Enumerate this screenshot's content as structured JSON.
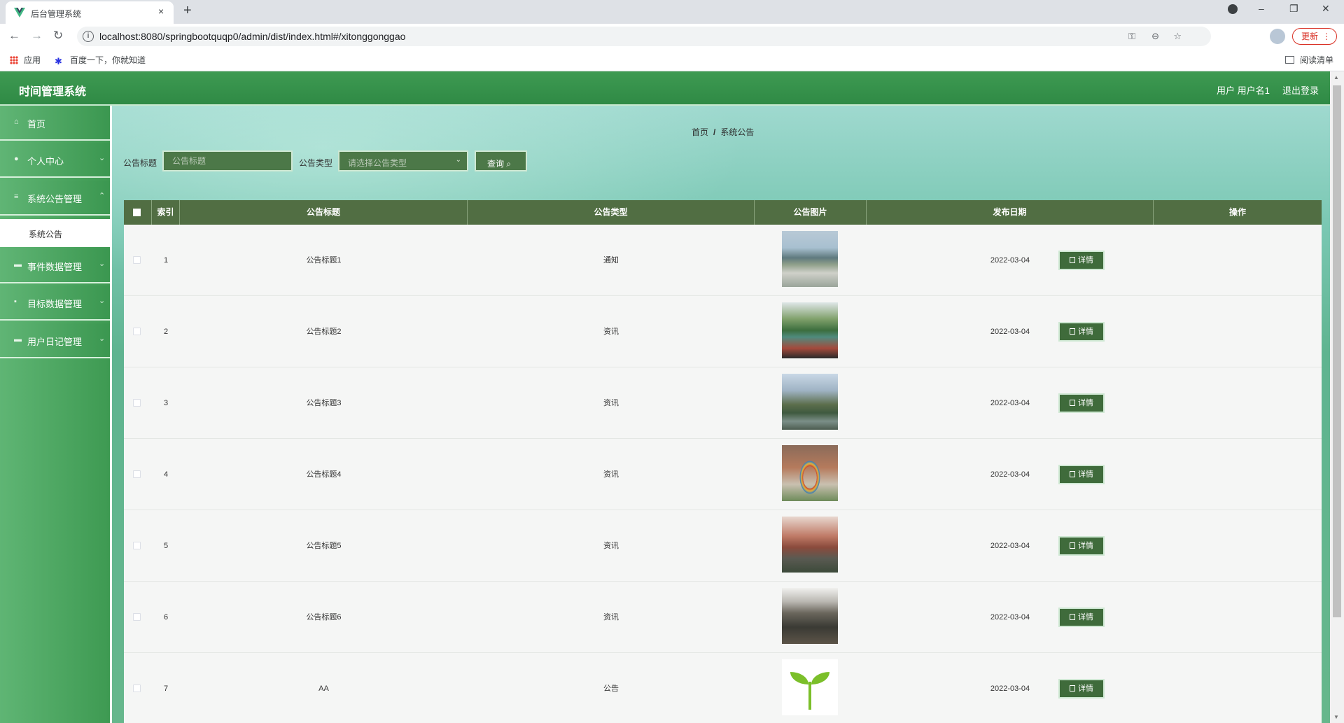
{
  "browser": {
    "tab_title": "后台管理系统",
    "tab_close": "×",
    "new_tab": "+",
    "url": "localhost:8080/springbootquqp0/admin/dist/index.html#/xitonggonggao",
    "update_label": "更新",
    "bookmarks": [
      "应用",
      "百度一下，你就知道"
    ],
    "reading_list": "阅读清单"
  },
  "app": {
    "title": "时间管理系统",
    "user_label": "用户 用户名1",
    "logout": "退出登录"
  },
  "sidebar": {
    "items": [
      {
        "label": "首页",
        "icon": "home-icon",
        "glyph": "⌂"
      },
      {
        "label": "个人中心",
        "icon": "user-icon",
        "glyph": "●"
      },
      {
        "label": "系统公告管理",
        "icon": "list-icon",
        "glyph": "≡"
      },
      {
        "label": "事件数据管理",
        "icon": "ticket-icon",
        "glyph": "▬"
      },
      {
        "label": "目标数据管理",
        "icon": "grid-icon",
        "glyph": "▪"
      },
      {
        "label": "用户日记管理",
        "icon": "storage-icon",
        "glyph": "▬"
      }
    ],
    "submenu_active": "系统公告"
  },
  "breadcrumb": {
    "home": "首页",
    "separator": "/",
    "current": "系统公告"
  },
  "search": {
    "title_label": "公告标题",
    "title_placeholder": "公告标题",
    "type_label": "公告类型",
    "type_placeholder": "请选择公告类型",
    "query_button": "查询"
  },
  "table": {
    "headers": [
      "索引",
      "公告标题",
      "公告类型",
      "公告图片",
      "发布日期",
      "操作"
    ],
    "detail_label": "详情",
    "rows": [
      {
        "index": "1",
        "title": "公告标题1",
        "type": "通知",
        "date": "2022-03-04",
        "image": "buildings"
      },
      {
        "index": "2",
        "title": "公告标题2",
        "type": "资讯",
        "date": "2022-03-04",
        "image": "court"
      },
      {
        "index": "3",
        "title": "公告标题3",
        "type": "资讯",
        "date": "2022-03-04",
        "image": "lake"
      },
      {
        "index": "4",
        "title": "公告标题4",
        "type": "资讯",
        "date": "2022-03-04",
        "image": "sculpture"
      },
      {
        "index": "5",
        "title": "公告标题5",
        "type": "资讯",
        "date": "2022-03-04",
        "image": "campus"
      },
      {
        "index": "6",
        "title": "公告标题6",
        "type": "资讯",
        "date": "2022-03-04",
        "image": "room"
      },
      {
        "index": "7",
        "title": "AA",
        "type": "公告",
        "date": "2022-03-04",
        "image": "sprout"
      }
    ]
  },
  "colors": {
    "header_green": "#3e9a52",
    "table_header": "#516e43",
    "control_bg": "#4c7848",
    "update_red": "#d93025"
  }
}
